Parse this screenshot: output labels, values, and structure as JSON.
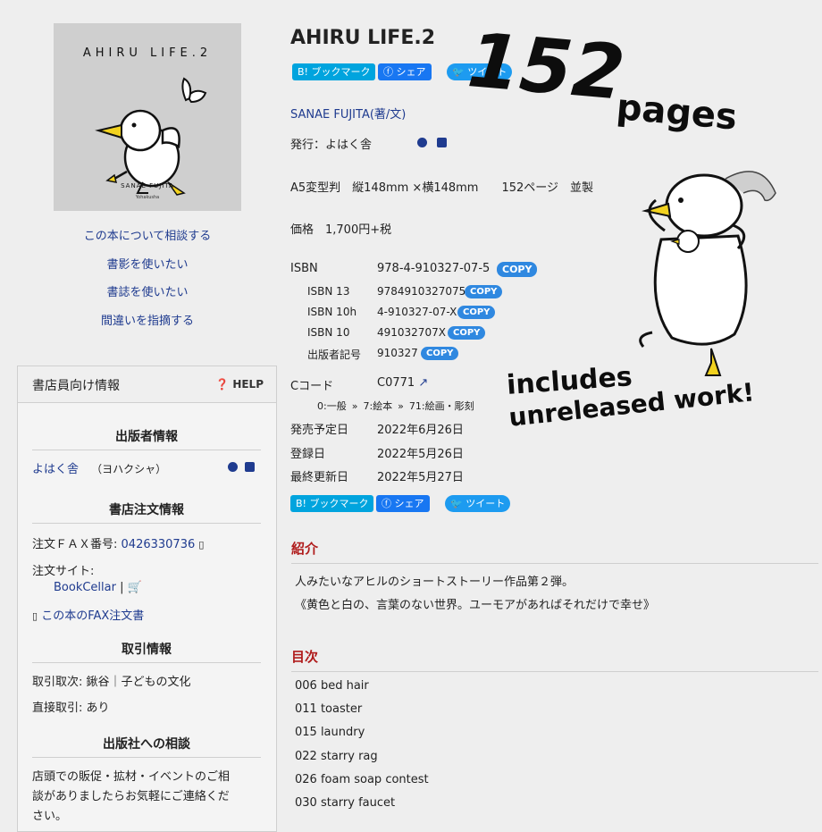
{
  "cover": {
    "title": "AHIRU LIFE.2",
    "author": "SANAE FUJITA",
    "publisher": "Yohakusha"
  },
  "left_links": [
    "この本について相談する",
    "書影を使いたい",
    "書誌を使いたい",
    "間違いを指摘する"
  ],
  "panel": {
    "title": "書店員向け情報",
    "help": "HELP",
    "publisher_heading": "出版者情報",
    "publisher_name": "よはく舎",
    "publisher_kana": "（ヨハクシャ）",
    "order_heading": "書店注文情報",
    "fax_label": "注文ＦＡＸ番号:",
    "fax_number": "0426330736",
    "order_site_label": "注文サイト:",
    "order_site": "BookCellar",
    "fax_order_link": "この本のFAX注文書",
    "trade_heading": "取引情報",
    "trade_agent": "取引取次: 鍬谷｜子どもの文化",
    "direct_trade": "直接取引: あり",
    "consult_heading": "出版社への相談",
    "consult_text_1": "店頭での販促・拡材・イベントのご相",
    "consult_text_2": "談がありましたらお気軽にご連絡くだ",
    "consult_text_3": "さい。"
  },
  "book": {
    "title": "AHIRU LIFE.2",
    "author": "SANAE FUJITA(著/文)",
    "publisher_line": "発行：よはく舎",
    "format": "A5変型判　縦148mm ×横148mm　　152ページ　並製",
    "price": "価格　1,700円+税"
  },
  "share": {
    "hatena": "B! ブックマーク",
    "facebook": "シェア",
    "twitter": "ツイート"
  },
  "copy_label": "COPY",
  "isbn": {
    "label": "ISBN",
    "value": "978-4-910327-07-5",
    "rows": [
      {
        "label": "ISBN 13",
        "value": "9784910327075"
      },
      {
        "label": "ISBN 10h",
        "value": "4-910327-07-X"
      },
      {
        "label": "ISBN 10",
        "value": "491032707X"
      },
      {
        "label": "出版者記号",
        "value": "910327"
      }
    ]
  },
  "ccode": {
    "label": "Cコード",
    "value": "C0771",
    "c1": "0:一般",
    "c2": "7:絵本",
    "c3": "71:絵画・彫刻"
  },
  "dates": [
    {
      "label": "発売予定日",
      "value": "2022年6月26日"
    },
    {
      "label": "登録日",
      "value": "2022年5月26日"
    },
    {
      "label": "最終更新日",
      "value": "2022年5月27日"
    }
  ],
  "intro": {
    "heading": "紹介",
    "line1": "人みたいなアヒルのショートストーリー作品第２弾。",
    "line2": "《黄色と白の、言葉のない世界。ユーモアがあればそれだけで幸せ》"
  },
  "toc": {
    "heading": "目次",
    "items": [
      "006 bed hair",
      "011 toaster",
      "015 laundry",
      "022 starry rag",
      "026 foam soap contest",
      "030 starry faucet"
    ]
  },
  "overlay": {
    "big_number": "152",
    "pages": "pages",
    "line1": "includes",
    "line2": "unreleased work!"
  },
  "colors": {
    "link": "#1f3b8f",
    "section_heading": "#b01c1c",
    "copy_button": "#2f88e0",
    "duck_beak": "#f2d21f"
  }
}
